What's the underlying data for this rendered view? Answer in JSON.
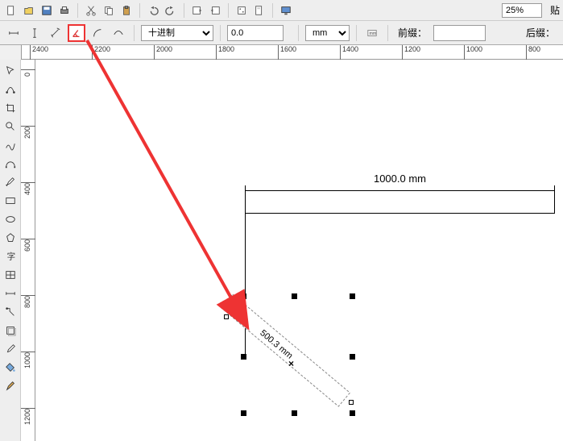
{
  "zoom": "25%",
  "paste_label": "贴",
  "decimal_style": "十进制",
  "value_field": "0.0",
  "unit_field": "mm",
  "prefix_label": "前缀：",
  "suffix_label": "后缀：",
  "ruler_h": [
    "2400",
    "2200",
    "2000",
    "1800",
    "1600",
    "1400",
    "1200",
    "1000",
    "800"
  ],
  "ruler_v": [
    "0",
    "200",
    "400",
    "600",
    "800",
    "1000",
    "1200"
  ],
  "dimension_h_text": "1000.0 mm",
  "dimension_diag_text": "500.3 mm",
  "toolbar_top_icons": [
    "new",
    "open",
    "save",
    "print",
    "cut",
    "copy",
    "paste",
    "undo",
    "redo",
    "import",
    "export",
    "options",
    "page",
    "display"
  ],
  "toolbar_second_icons": [
    "dim-h",
    "dim-v",
    "dim-parallel",
    "dim-angle",
    "dim-radius",
    "dim-curve"
  ],
  "toolbox_icons": [
    "pick",
    "shape",
    "crop",
    "zoom",
    "freehand",
    "bezier",
    "pen",
    "rectangle",
    "ellipse",
    "polygon",
    "text",
    "table",
    "dimension",
    "connector",
    "effects",
    "eyedrop",
    "fill",
    "outline"
  ]
}
